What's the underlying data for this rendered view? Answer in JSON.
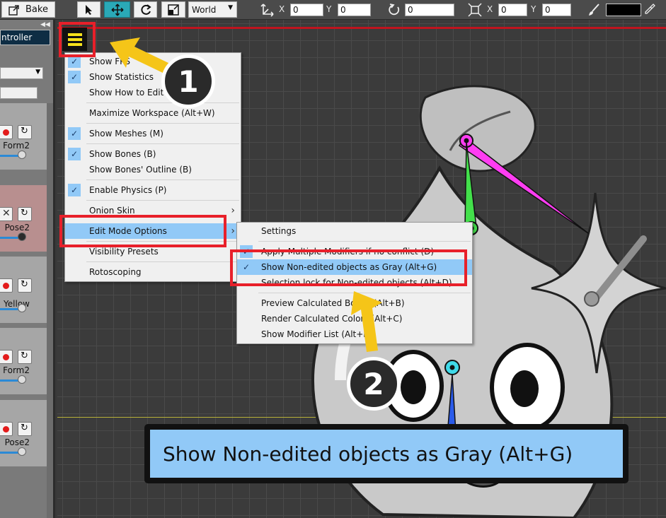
{
  "toolbar": {
    "bake_label": "Bake",
    "space_select": "World",
    "pos_x_label": "X",
    "pos_x_value": "0",
    "pos_y_label": "Y",
    "pos_y_value": "0",
    "rotation_value": "0",
    "scale_x_label": "X",
    "scale_x_value": "0",
    "scale_y_label": "Y",
    "scale_y_value": "0",
    "color_value": "#000000"
  },
  "left_panel": {
    "controller_tab": "ntroller",
    "rows": [
      {
        "label": "Form2"
      },
      {
        "label": "Pose2"
      },
      {
        "label": "Yellow"
      },
      {
        "label": "Form2"
      },
      {
        "label": "Pose2"
      }
    ]
  },
  "main_menu": {
    "items": [
      {
        "label": "Show FPS",
        "checked": true
      },
      {
        "label": "Show Statistics",
        "checked": true
      },
      {
        "label": "Show How to Edit",
        "checked": false
      },
      {
        "label": "Maximize Workspace (Alt+W)",
        "checked": false
      },
      {
        "label": "Show Meshes (M)",
        "checked": true
      },
      {
        "label": "Show Bones (B)",
        "checked": true
      },
      {
        "label": "Show Bones' Outline (B)",
        "checked": false
      },
      {
        "label": "Enable Physics (P)",
        "checked": true
      },
      {
        "label": "Onion Skin",
        "checked": false
      },
      {
        "label": "Edit Mode Options",
        "checked": false
      },
      {
        "label": "Visibility Presets",
        "checked": false
      },
      {
        "label": "Rotoscoping",
        "checked": false
      }
    ]
  },
  "submenu": {
    "items": [
      {
        "label": "Settings",
        "checked": false
      },
      {
        "label": "Apply Multiple Modifiers if no conflict (D)",
        "checked": true
      },
      {
        "label": "Show Non-edited objects as Gray (Alt+G)",
        "checked": true
      },
      {
        "label": "Selection lock for Non-edited objects (Alt+D)",
        "checked": false
      },
      {
        "label": "Preview Calculated Bones (Alt+B)",
        "checked": false
      },
      {
        "label": "Render Calculated Colors (Alt+C)",
        "checked": false
      },
      {
        "label": "Show Modifier List (Alt+M)",
        "checked": false
      }
    ]
  },
  "callouts": {
    "step1": "1",
    "step2": "2"
  },
  "zoom_label": "Show Non-edited objects as Gray (Alt+G)",
  "colors": {
    "highlight": "#91c9f7",
    "annotation_red": "#e8202a",
    "annotation_arrow": "#f5c518",
    "bone_magenta": "#ff3df2",
    "bone_green": "#43e04b",
    "bone_cyan": "#3fd9e8",
    "bone_blue": "#2a5bea"
  }
}
